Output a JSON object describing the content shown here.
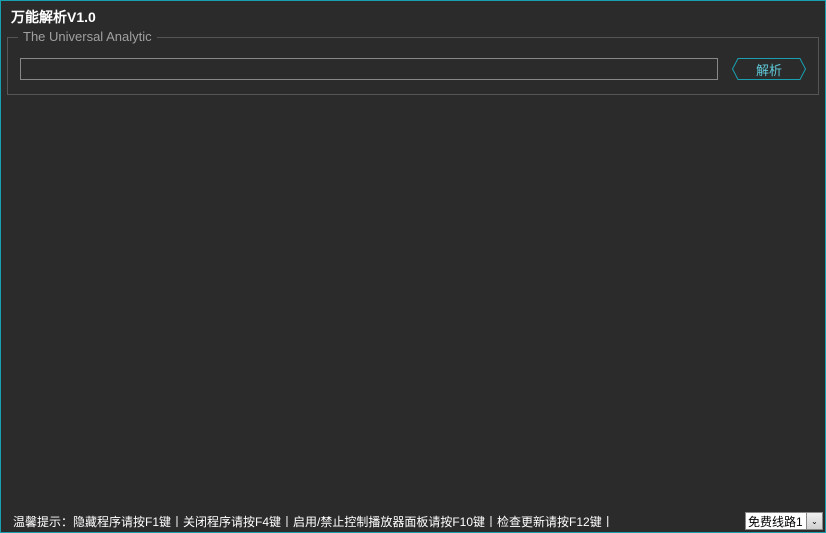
{
  "window": {
    "title": "万能解析V1.0"
  },
  "group": {
    "label": "The Universal Analytic",
    "input_value": "",
    "parse_button": "解析"
  },
  "status": {
    "text": "温馨提示：隐藏程序请按F1键丨关闭程序请按F4键丨启用/禁止控制播放器面板请按F10键丨检查更新请按F12键丨"
  },
  "line_selector": {
    "selected": "免费线路1"
  },
  "colors": {
    "accent": "#1a9fb0",
    "background": "#2b2b2b"
  }
}
